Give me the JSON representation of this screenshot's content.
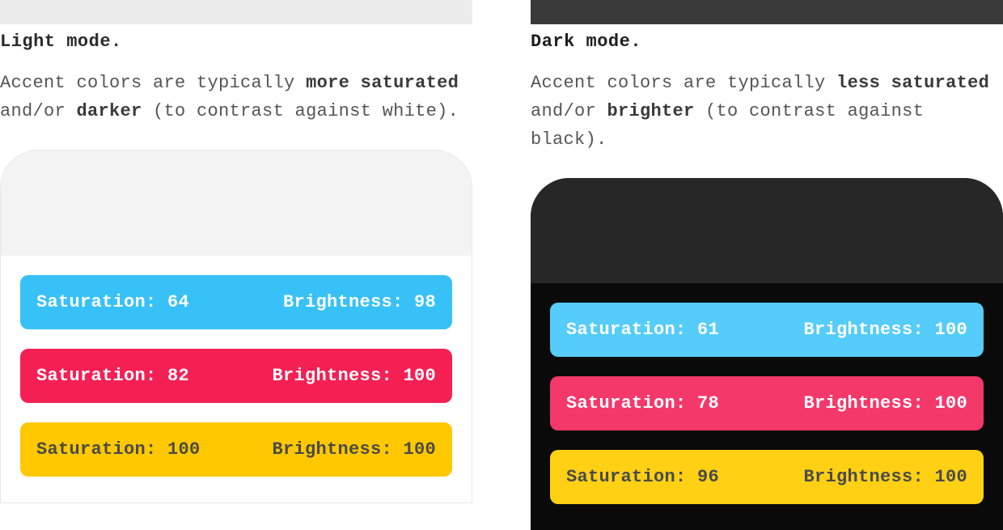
{
  "light": {
    "title": "Light mode.",
    "desc_pre": "Accent colors are typically ",
    "desc_b1": "more saturated",
    "desc_mid": " and/or ",
    "desc_b2": "darker",
    "desc_post": " (to contrast against white).",
    "swatches": [
      {
        "sat_label": "Saturation: 64",
        "bri_label": "Brightness: 98",
        "saturation": 64,
        "brightness": 98,
        "color": "#37c1f7"
      },
      {
        "sat_label": "Saturation: 82",
        "bri_label": "Brightness: 100",
        "saturation": 82,
        "brightness": 100,
        "color": "#f42054"
      },
      {
        "sat_label": "Saturation: 100",
        "bri_label": "Brightness: 100",
        "saturation": 100,
        "brightness": 100,
        "color": "#ffc800"
      }
    ]
  },
  "dark": {
    "title": "Dark mode.",
    "desc_pre": "Accent colors are typically ",
    "desc_b1": "less saturated",
    "desc_mid": " and/or ",
    "desc_b2": "brighter",
    "desc_post": " (to contrast against black).",
    "swatches": [
      {
        "sat_label": "Saturation: 61",
        "bri_label": "Brightness: 100",
        "saturation": 61,
        "brightness": 100,
        "color": "#55ccf9"
      },
      {
        "sat_label": "Saturation: 78",
        "bri_label": "Brightness: 100",
        "saturation": 78,
        "brightness": 100,
        "color": "#f5386a"
      },
      {
        "sat_label": "Saturation: 96",
        "bri_label": "Brightness: 100",
        "saturation": 96,
        "brightness": 100,
        "color": "#ffd014"
      }
    ]
  }
}
